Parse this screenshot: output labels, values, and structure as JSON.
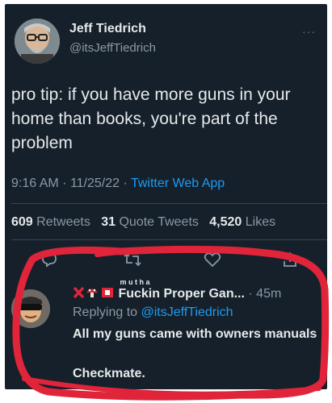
{
  "tweet": {
    "author_name": "Jeff Tiedrich",
    "author_handle": "@itsJeffTiedrich",
    "more_label": "···",
    "text": "pro tip: if you have more guns in your home than books, you're part of the problem",
    "time": "9:16 AM",
    "date": "11/25/22",
    "separator": "·",
    "app": "Twitter Web App",
    "retweets_count": "609",
    "retweets_label": "Retweets",
    "quote_count": "31",
    "quote_label": "Quote Tweets",
    "likes_count": "4,520",
    "likes_label": "Likes"
  },
  "reply": {
    "display_name": "Fuckin Proper Gan...",
    "name_superscript": "m u t h a",
    "time": "· 45m",
    "replying_prefix": "Replying to",
    "replying_to": "@itsJeffTiedrich",
    "text_line1": "All my guns came with owners manuals",
    "text_line2": "Checkmate."
  },
  "icons": [
    "reply-icon",
    "retweet-icon",
    "like-icon",
    "share-icon",
    "more-icon",
    "cross-emoji-icon",
    "mushroom-emoji-icon",
    "flag-emoji-icon"
  ],
  "colors": {
    "background": "#15202b",
    "text_primary": "#e7e9ea",
    "text_secondary": "#8b98a5",
    "link": "#1d9bf0",
    "highlight": "#e0243a"
  }
}
